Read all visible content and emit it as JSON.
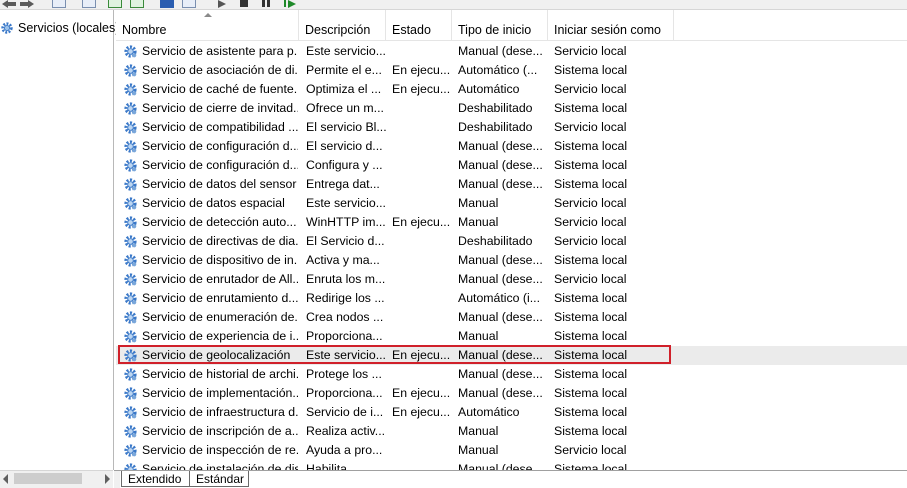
{
  "tree": {
    "root_label": "Servicios (locales)"
  },
  "columns": [
    "Nombre",
    "Descripción",
    "Estado",
    "Tipo de inicio",
    "Iniciar sesión como"
  ],
  "rows": [
    {
      "name": "Servicio de asistente para p...",
      "desc": "Este servicio...",
      "status": "",
      "startup": "Manual (dese...",
      "logon": "Servicio local"
    },
    {
      "name": "Servicio de asociación de di...",
      "desc": "Permite el e...",
      "status": "En ejecu...",
      "startup": "Automático (...",
      "logon": "Sistema local"
    },
    {
      "name": "Servicio de caché de fuente...",
      "desc": "Optimiza el ...",
      "status": "En ejecu...",
      "startup": "Automático",
      "logon": "Servicio local"
    },
    {
      "name": "Servicio de cierre de invitad...",
      "desc": "Ofrece un m...",
      "status": "",
      "startup": "Deshabilitado",
      "logon": "Sistema local"
    },
    {
      "name": "Servicio de compatibilidad ...",
      "desc": "El servicio Bl...",
      "status": "",
      "startup": "Deshabilitado",
      "logon": "Servicio local"
    },
    {
      "name": "Servicio de configuración d...",
      "desc": "El servicio d...",
      "status": "",
      "startup": "Manual (dese...",
      "logon": "Sistema local"
    },
    {
      "name": "Servicio de configuración d...",
      "desc": "Configura y ...",
      "status": "",
      "startup": "Manual (dese...",
      "logon": "Sistema local"
    },
    {
      "name": "Servicio de datos del sensor",
      "desc": "Entrega dat...",
      "status": "",
      "startup": "Manual (dese...",
      "logon": "Sistema local"
    },
    {
      "name": "Servicio de datos espacial",
      "desc": "Este servicio...",
      "status": "",
      "startup": "Manual",
      "logon": "Servicio local"
    },
    {
      "name": "Servicio de detección auto...",
      "desc": "WinHTTP im...",
      "status": "En ejecu...",
      "startup": "Manual",
      "logon": "Servicio local"
    },
    {
      "name": "Servicio de directivas de dia...",
      "desc": "El Servicio d...",
      "status": "",
      "startup": "Deshabilitado",
      "logon": "Servicio local"
    },
    {
      "name": "Servicio de dispositivo de in...",
      "desc": "Activa y ma...",
      "status": "",
      "startup": "Manual (dese...",
      "logon": "Sistema local"
    },
    {
      "name": "Servicio de enrutador de All...",
      "desc": "Enruta los m...",
      "status": "",
      "startup": "Manual (dese...",
      "logon": "Servicio local"
    },
    {
      "name": "Servicio de enrutamiento d...",
      "desc": "Redirige los ...",
      "status": "",
      "startup": "Automático (i...",
      "logon": "Sistema local"
    },
    {
      "name": "Servicio de enumeración de...",
      "desc": "Crea nodos ...",
      "status": "",
      "startup": "Manual (dese...",
      "logon": "Sistema local"
    },
    {
      "name": "Servicio de experiencia de i...",
      "desc": "Proporciona...",
      "status": "",
      "startup": "Manual",
      "logon": "Sistema local"
    },
    {
      "name": "Servicio de geolocalización",
      "desc": "Este servicio...",
      "status": "En ejecu...",
      "startup": "Manual (dese...",
      "logon": "Sistema local",
      "highlight": true
    },
    {
      "name": "Servicio de historial de archi...",
      "desc": "Protege los ...",
      "status": "",
      "startup": "Manual (dese...",
      "logon": "Sistema local"
    },
    {
      "name": "Servicio de implementación...",
      "desc": "Proporciona...",
      "status": "En ejecu...",
      "startup": "Manual (dese...",
      "logon": "Sistema local"
    },
    {
      "name": "Servicio de infraestructura d...",
      "desc": "Servicio de i...",
      "status": "En ejecu...",
      "startup": "Automático",
      "logon": "Sistema local"
    },
    {
      "name": "Servicio de inscripción de a...",
      "desc": "Realiza activ...",
      "status": "",
      "startup": "Manual",
      "logon": "Sistema local"
    },
    {
      "name": "Servicio de inspección de re...",
      "desc": "Ayuda a pro...",
      "status": "",
      "startup": "Manual",
      "logon": "Servicio local"
    },
    {
      "name": "Servicio de instalación de dis...",
      "desc": "Habilita...",
      "status": "",
      "startup": "Manual (dese...",
      "logon": "Sistema local"
    }
  ],
  "tabs": [
    "Extendido",
    "Estándar"
  ],
  "colors": {
    "highlight_border": "#d0202a",
    "gear_blue": "#3a78c8"
  }
}
